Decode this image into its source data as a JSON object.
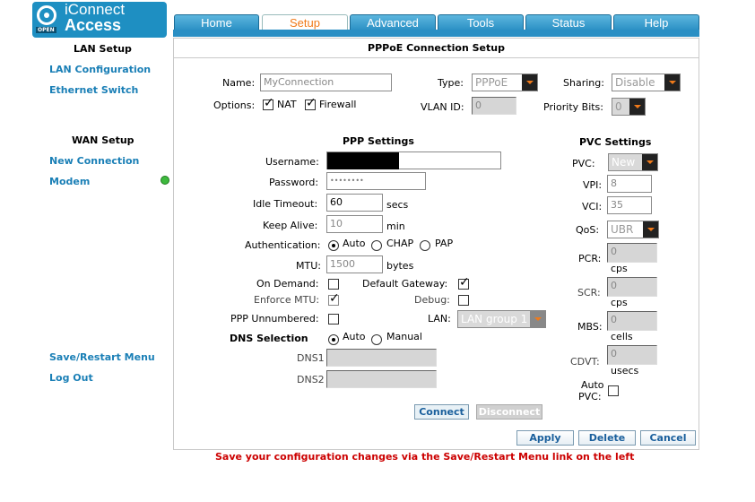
{
  "logo": {
    "brand_top": "iConnect",
    "brand_bottom": "Access",
    "badge": "OPEN"
  },
  "tabs": [
    {
      "label": "Home"
    },
    {
      "label": "Setup"
    },
    {
      "label": "Advanced"
    },
    {
      "label": "Tools"
    },
    {
      "label": "Status"
    },
    {
      "label": "Help"
    }
  ],
  "active_tab": "Setup",
  "sidebar": {
    "lan_heading": "LAN Setup",
    "lan_config": "LAN Configuration",
    "ethernet_switch": "Ethernet Switch",
    "wan_heading": "WAN Setup",
    "new_connection": "New Connection",
    "modem": "Modem",
    "save_restart": "Save/Restart Menu",
    "log_out": "Log Out"
  },
  "panel": {
    "title": "PPPoE Connection Setup",
    "name_label": "Name:",
    "name_value": "MyConnection",
    "type_label": "Type:",
    "type_value": "PPPoE",
    "sharing_label": "Sharing:",
    "sharing_value": "Disable",
    "options_label": "Options:",
    "nat_label": "NAT",
    "firewall_label": "Firewall",
    "vlan_label": "VLAN ID:",
    "vlan_value": "0",
    "priority_label": "Priority Bits:",
    "priority_value": "0"
  },
  "ppp": {
    "heading": "PPP Settings",
    "username_label": "Username:",
    "password_label": "Password:",
    "password_value": "••••••••",
    "idle_label": "Idle Timeout:",
    "idle_value": "60",
    "idle_unit": "secs",
    "keepalive_label": "Keep Alive:",
    "keepalive_value": "10",
    "keepalive_unit": "min",
    "auth_label": "Authentication:",
    "auth_auto": "Auto",
    "auth_chap": "CHAP",
    "auth_pap": "PAP",
    "mtu_label": "MTU:",
    "mtu_value": "1500",
    "mtu_unit": "bytes",
    "ondemand_label": "On Demand:",
    "defgw_label": "Default Gateway:",
    "enforce_label": "Enforce MTU:",
    "debug_label": "Debug:",
    "unnumbered_label": "PPP Unnumbered:",
    "lan_label": "LAN:",
    "lan_value": "LAN group 1"
  },
  "dns": {
    "heading": "DNS Selection",
    "auto": "Auto",
    "manual": "Manual",
    "dns1_label": "DNS1",
    "dns2_label": "DNS2"
  },
  "pvc": {
    "heading": "PVC Settings",
    "pvc_label": "PVC:",
    "pvc_value": "New",
    "vpi_label": "VPI:",
    "vpi_value": "8",
    "vci_label": "VCI:",
    "vci_value": "35",
    "qos_label": "QoS:",
    "qos_value": "UBR",
    "pcr_label": "PCR:",
    "pcr_value": "0",
    "pcr_unit": "cps",
    "scr_label": "SCR:",
    "scr_value": "0",
    "scr_unit": "cps",
    "mbs_label": "MBS:",
    "mbs_value": "0",
    "mbs_unit": "cells",
    "cdvt_label": "CDVT:",
    "cdvt_value": "0",
    "cdvt_unit": "usecs",
    "autopvc_label_1": "Auto",
    "autopvc_label_2": "PVC:"
  },
  "buttons": {
    "connect": "Connect",
    "disconnect": "Disconnect",
    "apply": "Apply",
    "delete": "Delete",
    "cancel": "Cancel"
  },
  "footer_note": "Save your configuration changes via the Save/Restart Menu link on the left",
  "colors": {
    "accent": "#2a8fc4",
    "active_tab_text": "#f07a1a",
    "link": "#1a7fb6",
    "warning": "#cc0000",
    "status_ok": "#3db93d"
  }
}
